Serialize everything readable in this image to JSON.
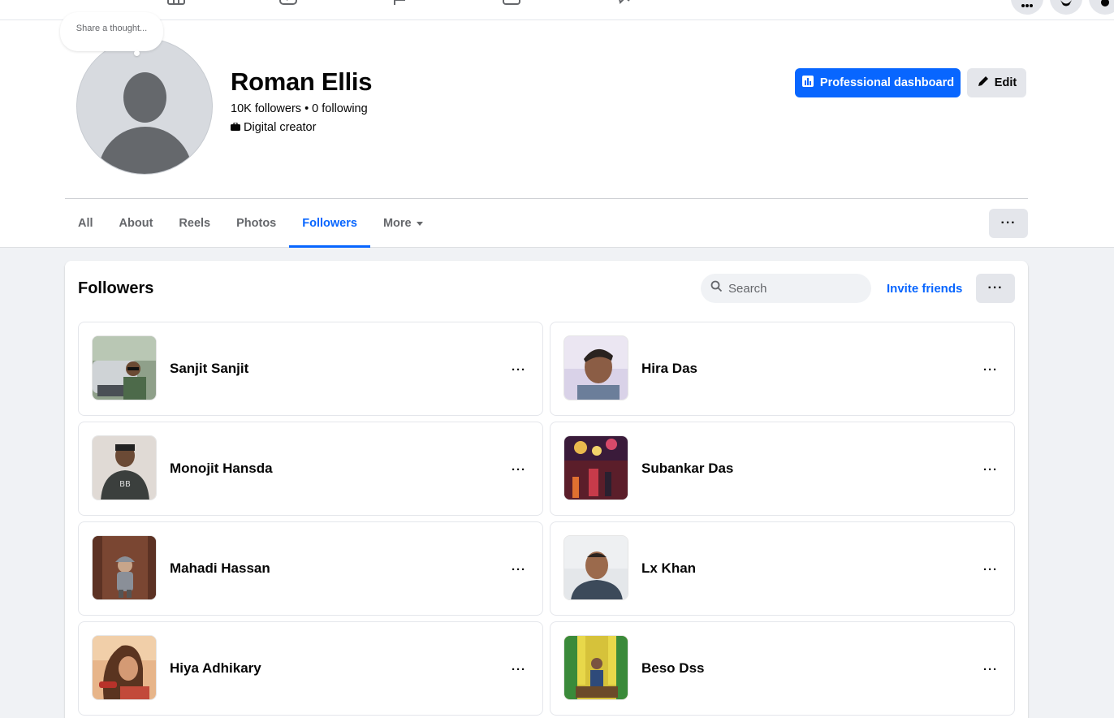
{
  "topnav": {
    "icons": [
      "home-icon",
      "watch-icon",
      "pages-icon",
      "marketplace-icon",
      "gaming-icon"
    ],
    "right_icons": [
      "menu-grid-icon",
      "messenger-icon",
      "settings-icon"
    ]
  },
  "profile": {
    "thought_placeholder": "Share a thought...",
    "name": "Roman Ellis",
    "stats": "10K followers • 0 following",
    "category": "Digital creator",
    "pro_dashboard_label": "Professional dashboard",
    "edit_label": "Edit"
  },
  "tabs": [
    {
      "label": "All"
    },
    {
      "label": "About"
    },
    {
      "label": "Reels"
    },
    {
      "label": "Photos"
    },
    {
      "label": "Followers",
      "active": true
    },
    {
      "label": "More"
    }
  ],
  "followers": {
    "title": "Followers",
    "search_placeholder": "Search",
    "invite_label": "Invite friends",
    "more_label": "···",
    "items": [
      {
        "name": "Sanjit Sanjit",
        "more": "···"
      },
      {
        "name": "Hira Das",
        "more": "···"
      },
      {
        "name": "Monojit Hansda",
        "more": "···"
      },
      {
        "name": "Subankar Das",
        "more": "···"
      },
      {
        "name": "Mahadi Hassan",
        "more": "···"
      },
      {
        "name": "Lx Khan",
        "more": "···"
      },
      {
        "name": "Hiya Adhikary",
        "more": "···"
      },
      {
        "name": "Beso Dss",
        "more": "···"
      }
    ]
  },
  "tabs_more_label": "···",
  "colors": {
    "accent": "#0866ff",
    "page_bg": "#f0f2f5",
    "button_grey": "#e4e6eb",
    "secondary_text": "#65676b"
  }
}
